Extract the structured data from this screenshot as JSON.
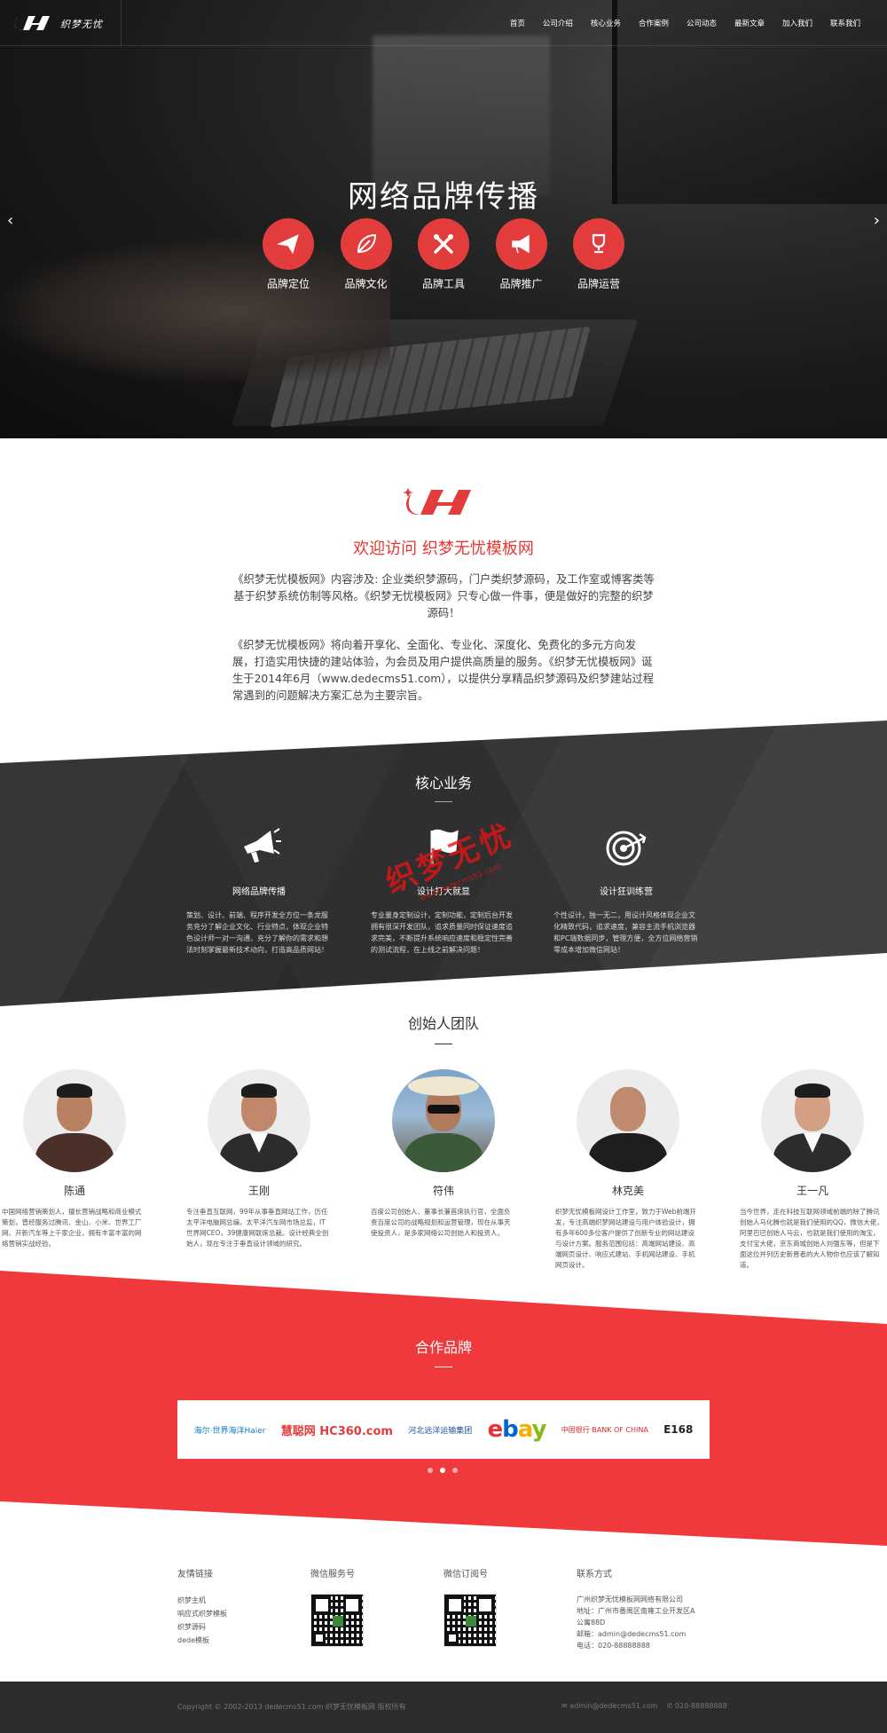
{
  "header": {
    "logo_text": "织梦无忧",
    "nav": [
      "首页",
      "公司介绍",
      "核心业务",
      "合作案例",
      "公司动态",
      "最新文章",
      "加入我们",
      "联系我们"
    ]
  },
  "hero": {
    "title": "网络品牌传播",
    "prev_arrow": "‹",
    "next_arrow": "›",
    "items": [
      {
        "label": "品牌定位",
        "icon": "paper-plane-icon"
      },
      {
        "label": "品牌文化",
        "icon": "leaf-icon"
      },
      {
        "label": "品牌工具",
        "icon": "tools-icon"
      },
      {
        "label": "品牌推广",
        "icon": "megaphone-icon"
      },
      {
        "label": "品牌运营",
        "icon": "trophy-icon"
      }
    ]
  },
  "welcome": {
    "title": "欢迎访问 织梦无忧模板网",
    "p1": "《织梦无忧模板网》内容涉及: 企业类织梦源码，门户类织梦源码，及工作室或博客类等基于织梦系统仿制等风格。《织梦无忧模板网》只专心做一件事，便是做好的完整的织梦源码！",
    "p2": "《织梦无忧模板网》将向着开享化、全面化、专业化、深度化、免费化的多元方向发展，打造实用快捷的建站体验，为会员及用户提供高质量的服务。《织梦无忧模板网》诞生于2014年6月（www.dedecms51.com），以提供分享精品织梦源码及织梦建站过程常遇到的问题解决方案汇总为主要宗旨。"
  },
  "core": {
    "title": "核心业务",
    "columns": [
      {
        "title": "网络品牌传播",
        "icon": "megaphone-icon",
        "text": "策划、设计、前端、程序开发全方位一条龙服务充分了解企业文化、行业特点，体现企业特色设计师一对一沟通，充分了解你的需求和想法时刻掌握最新技术动向，打造高品质网站！"
      },
      {
        "title": "设计打大就显",
        "icon": "flag-icon",
        "text": "专业量身定制设计，定制功能，定制后台开发拥有很深开发团队，追求质量同时保证速度追求完美，不断提升系统响应速度和稳定性完善的测试流程，在上线之前解决问题！"
      },
      {
        "title": "设计狂训练营",
        "icon": "target-icon",
        "text": "个性设计，独一无二，用设计风格体现企业文化精致代码，追求速度，兼容主流手机浏览器和PC端数据同步，管理方便，全方位网络营销零成本增加微信网站！"
      }
    ],
    "watermark": "织梦无忧",
    "watermark_url": "www.dedecms51.com"
  },
  "team": {
    "title": "创始人团队",
    "members": [
      {
        "name": "陈通",
        "desc": "中国网络营销策划人，擅长营销战略和商业模式策划，曾经服务过腾讯、金山、小米、世界工厂网、开新汽车等上千家企业，拥有丰富丰富的网络营销实战经验。"
      },
      {
        "name": "王刚",
        "desc": "专注垂直互联网，99年从事垂直网站工作，历任太平洋电脑网总编，太平洋汽车网市场总监，IT世界网CEO，39健康网联席总裁。设计经典全创始人，现在专注于垂直设计领域的研究。"
      },
      {
        "name": "符伟",
        "desc": "百度公司创始人、董事长兼首席执行官，全面负责百度公司的战略规划和运营管理，现在从事天使投资人，是多家网络公司创始人和投资人。"
      },
      {
        "name": "林克美",
        "desc": "织梦无忧模板网设计工作室，致力于Web前端开发，专注高端织梦网站建设与用户体验设计，拥有多年600多位客户提供了创新专业的网站建设与设计方案。服务范围包括：高端网站建设、高端网页设计、响应式建站、手机网站建设、手机网页设计。"
      },
      {
        "name": "王一凡",
        "desc": "当今世界，走在科技互联网领域前端的除了腾讯创始人马化腾也就是我们使用的QQ，微信大佬，阿里巴巴创始人马云，也就是我们使用的淘宝，支付宝大佬，京东商城创始人刘强东等，但是下面这位并列历史新晋者的大人物你也应该了解知道。"
      }
    ]
  },
  "partners": {
    "title": "合作品牌",
    "brands": [
      "海尔·世界海洋Haier",
      "慧聪网 HC360.com",
      "河北远洋运输集团",
      "ebay",
      "中国银行·BANK OF CHINA",
      "E168"
    ]
  },
  "footer": {
    "links_title": "友情链接",
    "links": [
      "织梦主机",
      "响应式织梦模板",
      "织梦源码",
      "dede模板"
    ],
    "wechat_service_title": "微信服务号",
    "wechat_sub_title": "微信订阅号",
    "contact_title": "联系方式",
    "contact_lines": [
      "广州织梦无忧模板网网络有限公司",
      "地址：广州市番禺区南雍工业开发区A",
      "公寓88D",
      "邮箱：admin@dedecms51.com",
      "电话：020-88888888"
    ],
    "copyright": "Copyright © 2002-2013 dedecms51.com 织梦无忧模板网 版权所有",
    "email_bottom": "✉ admin@dedecms51.com",
    "phone_bottom": "✆ 020-88888888"
  },
  "colors": {
    "accent": "#e8352f",
    "dark": "#333333",
    "partner_bg": "#f0393c"
  }
}
